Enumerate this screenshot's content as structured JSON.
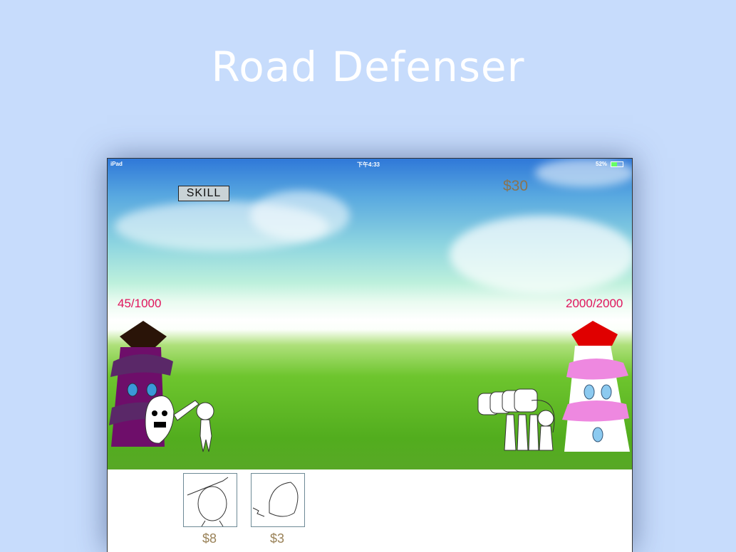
{
  "title": "Road Defenser",
  "status_bar": {
    "device": "iPad",
    "time": "下午4:33",
    "battery": "52%"
  },
  "hud": {
    "skill_label": "SKILL",
    "money": "$30"
  },
  "towers": {
    "player_hp": "45/1000",
    "enemy_hp": "2000/2000",
    "player_color": "#6e0e6a",
    "enemy_roof_color": "#e00000",
    "enemy_band_color": "#ee88e0"
  },
  "units_shop": [
    {
      "icon": "swordsman-unit-icon",
      "price": "$8"
    },
    {
      "icon": "shield-unit-icon",
      "price": "$3"
    }
  ]
}
